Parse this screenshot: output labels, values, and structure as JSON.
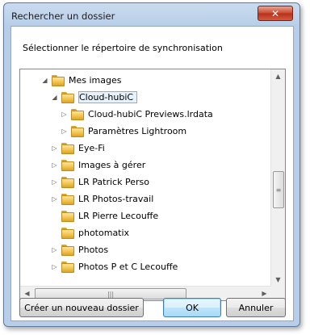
{
  "dialog": {
    "title": "Rechercher un dossier",
    "close_symbol": "✕",
    "description": "Sélectionner le répertoire de synchronisation"
  },
  "tree": {
    "items": [
      {
        "label": "Mes images",
        "expander": "◢",
        "level": 0
      },
      {
        "label": "Cloud-hubiC",
        "expander": "◢",
        "level": 1,
        "selected": true
      },
      {
        "label": "Cloud-hubiC Previews.lrdata",
        "expander": "▷",
        "level": 2
      },
      {
        "label": "Paramètres Lightroom",
        "expander": "▷",
        "level": 2
      },
      {
        "label": "Eye-Fi",
        "expander": "▷",
        "level": 1
      },
      {
        "label": "Images à gérer",
        "expander": "▷",
        "level": 1
      },
      {
        "label": "LR Patrick Perso",
        "expander": "▷",
        "level": 1
      },
      {
        "label": "LR Photos-travail",
        "expander": "▷",
        "level": 1
      },
      {
        "label": "LR Pierre Lecouffe",
        "expander": "",
        "level": 1
      },
      {
        "label": "photomatix",
        "expander": "",
        "level": 1
      },
      {
        "label": "Photos",
        "expander": "▷",
        "level": 1
      },
      {
        "label": "Photos P et C Lecouffe",
        "expander": "▷",
        "level": 1
      }
    ],
    "scroll": {
      "up": "▲",
      "down": "▼",
      "left": "◀",
      "right": "▶",
      "grip_v": "≡",
      "grip_h": "|||"
    }
  },
  "buttons": {
    "new_folder": "Créer un nouveau dossier",
    "ok": "OK",
    "cancel": "Annuler"
  }
}
